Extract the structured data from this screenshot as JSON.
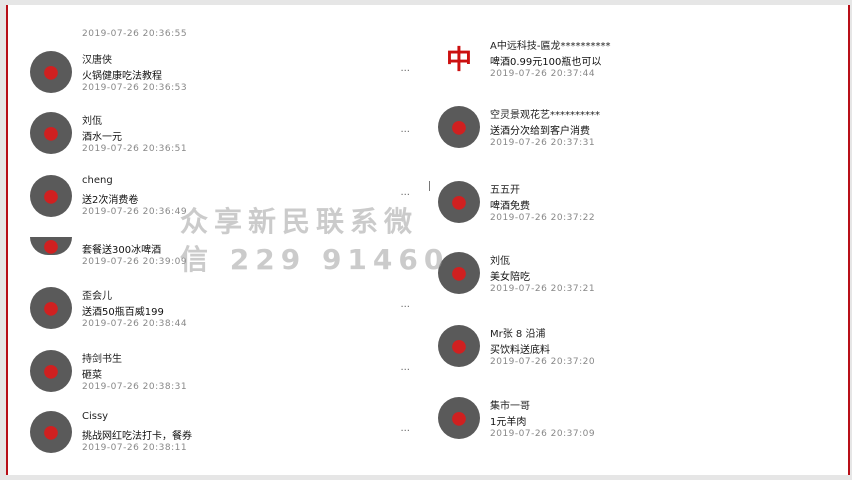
{
  "left": [
    {
      "name": "",
      "text": "",
      "time": "2019-07-26 20:36:55",
      "avatar": "avatar-icon",
      "more": "..."
    },
    {
      "name": "汉唐侠",
      "text": "火锅健康吃法教程",
      "time": "2019-07-26 20:36:53",
      "avatar": "avatar-icon",
      "more": "..."
    },
    {
      "name": "刘佤",
      "text": "酒水一元",
      "time": "2019-07-26 20:36:51",
      "avatar": "avatar-icon",
      "more": "..."
    },
    {
      "name": "cheng",
      "text": "送2次消费卷",
      "time": "2019-07-26 20:36:49",
      "avatar": "avatar-icon",
      "more": "..."
    },
    {
      "name": "",
      "text": "套餐送300冰啤酒",
      "time": "2019-07-26 20:39:09",
      "avatar": "avatar-icon",
      "more": ""
    },
    {
      "name": "歪会儿",
      "text": "送酒50瓶百威199",
      "time": "2019-07-26 20:38:44",
      "avatar": "avatar-icon",
      "more": "..."
    },
    {
      "name": "持剑书生",
      "text": "砸菜",
      "time": "2019-07-26 20:38:31",
      "avatar": "avatar-icon",
      "more": "..."
    },
    {
      "name": "Cissy",
      "text": "挑战网红吃法打卡，餐券",
      "time": "2019-07-26 20:38:11",
      "avatar": "avatar-icon",
      "more": "..."
    }
  ],
  "right": [
    {
      "name": "A中远科技-匾龙**********",
      "text": "啤酒0.99元100瓶也可以",
      "time": "2019-07-26 20:37:44",
      "avatar": "logo-icon",
      "more": ""
    },
    {
      "name": "空灵景观花艺**********",
      "text": "送酒分次给到客户消费",
      "time": "2019-07-26 20:37:31",
      "avatar": "avatar-icon",
      "more": ""
    },
    {
      "name": "五五开",
      "text": "啤酒免费",
      "time": "2019-07-26 20:37:22",
      "avatar": "avatar-icon",
      "more": ""
    },
    {
      "name": "刘佤",
      "text": "美女陪吃",
      "time": "2019-07-26 20:37:21",
      "avatar": "avatar-icon",
      "more": ""
    },
    {
      "name": "Mr张 8 沿浦",
      "text": "买饮料送底料",
      "time": "2019-07-26 20:37:20",
      "avatar": "avatar-icon",
      "more": ""
    },
    {
      "name": "集市一哥",
      "text": "1元羊肉",
      "time": "2019-07-26 20:37:09",
      "avatar": "avatar-icon",
      "more": ""
    }
  ],
  "watermark": {
    "line1": "众享新民联系微",
    "line2": "信 229 91460"
  },
  "colors": {
    "border": "#b80f18",
    "avatar_mark": "#d02020"
  }
}
